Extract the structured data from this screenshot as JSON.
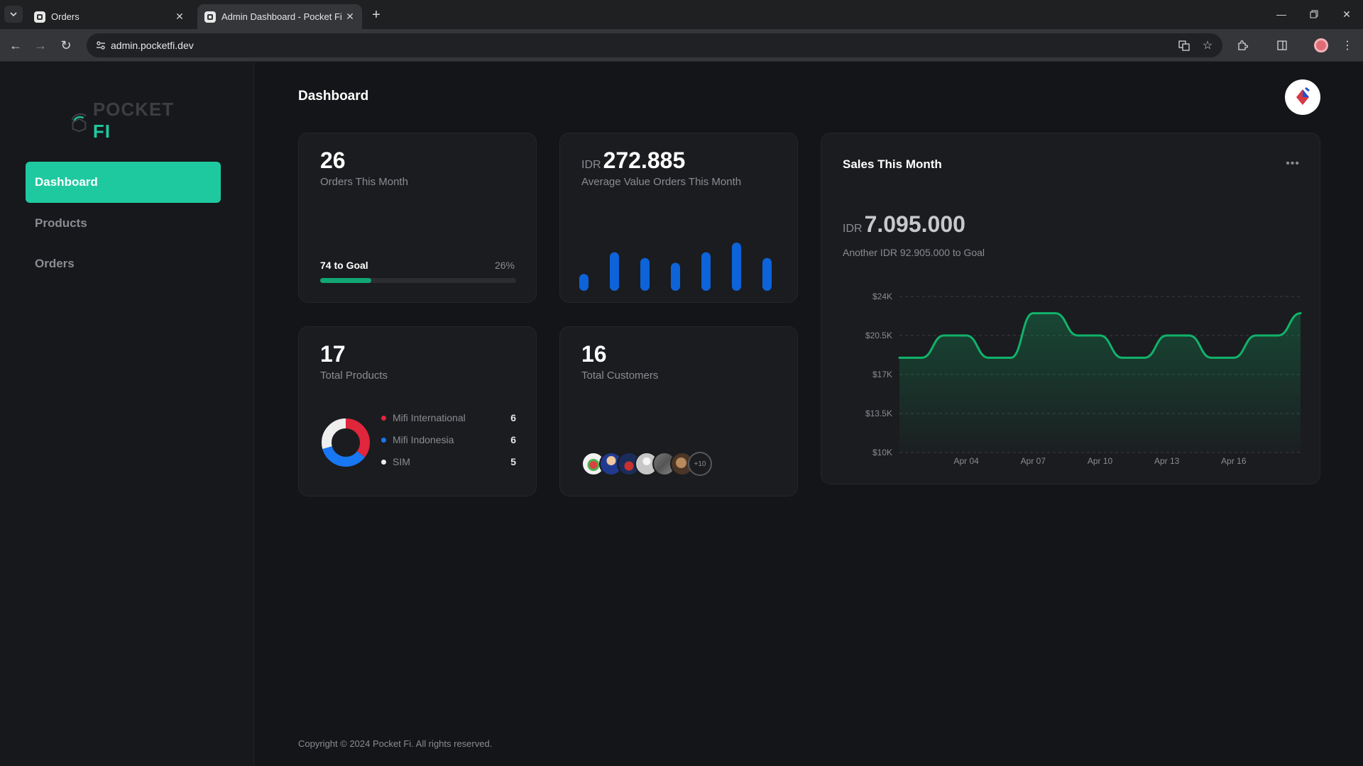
{
  "browser": {
    "tabs": [
      {
        "title": "Orders",
        "active": false
      },
      {
        "title": "Admin Dashboard - Pocket Fi",
        "active": true
      }
    ],
    "url": "admin.pocketfi.dev"
  },
  "sidebar": {
    "logo_text_main": "POCKET",
    "logo_text_accent": "FI",
    "items": [
      {
        "label": "Dashboard",
        "active": true
      },
      {
        "label": "Products",
        "active": false
      },
      {
        "label": "Orders",
        "active": false
      }
    ]
  },
  "header": {
    "title": "Dashboard"
  },
  "cards": {
    "orders": {
      "value": "26",
      "label": "Orders This Month",
      "goal_label": "74 to Goal",
      "goal_pct_text": "26%",
      "progress": 0.26
    },
    "avg_value": {
      "currency": "IDR",
      "value": "272.885",
      "label": "Average Value Orders This Month",
      "bars": [
        0.35,
        0.8,
        0.68,
        0.58,
        0.8,
        1.0,
        0.68
      ]
    },
    "products": {
      "value": "17",
      "label": "Total Products",
      "legend": [
        {
          "name": "Mifi International",
          "count": "6",
          "value": 6,
          "color": "#e0263c"
        },
        {
          "name": "Mifi Indonesia",
          "count": "6",
          "value": 6,
          "color": "#1877f2"
        },
        {
          "name": "SIM",
          "count": "5",
          "value": 5,
          "color": "#eeeeee"
        }
      ]
    },
    "customers": {
      "value": "16",
      "label": "Total Customers",
      "more_label": "+10"
    }
  },
  "sales": {
    "title": "Sales This Month",
    "currency": "IDR",
    "value": "7.095.000",
    "subtitle": "Another IDR 92.905.000 to Goal"
  },
  "chart_data": {
    "type": "area",
    "title": "Sales This Month",
    "y_ticks": [
      "$24K",
      "$20.5K",
      "$17K",
      "$13.5K",
      "$10K"
    ],
    "ylim": [
      10000,
      24000
    ],
    "x_ticks": [
      "Apr 04",
      "Apr 07",
      "Apr 10",
      "Apr 13",
      "Apr 16"
    ],
    "x": [
      "Apr 01",
      "Apr 02",
      "Apr 03",
      "Apr 04",
      "Apr 05",
      "Apr 06",
      "Apr 07",
      "Apr 08",
      "Apr 09",
      "Apr 10",
      "Apr 11",
      "Apr 12",
      "Apr 13",
      "Apr 14",
      "Apr 15",
      "Apr 16",
      "Apr 17",
      "Apr 18",
      "Apr 19"
    ],
    "values": [
      18500,
      18500,
      20500,
      20500,
      18500,
      18500,
      22500,
      22500,
      20500,
      20500,
      18500,
      18500,
      20500,
      20500,
      18500,
      18500,
      20500,
      20500,
      22500
    ],
    "grid": true,
    "color": "#10b36b"
  },
  "footer": {
    "text": "Copyright © 2024 Pocket Fi. All rights reserved."
  }
}
